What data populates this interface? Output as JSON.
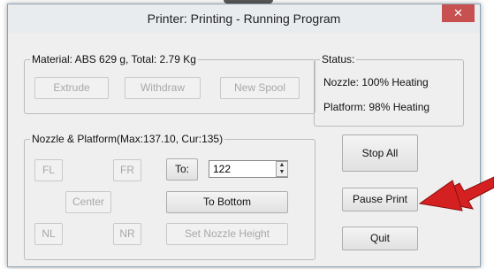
{
  "window": {
    "title": "Printer: Printing - Running Program",
    "close_glyph": "✕"
  },
  "material": {
    "legend": "Material: ABS 629 g,  Total: 2.79 Kg",
    "buttons": {
      "extrude": "Extrude",
      "withdraw": "Withdraw",
      "new_spool": "New Spool"
    }
  },
  "status": {
    "legend": "Status:",
    "nozzle": "Nozzle: 100%  Heating",
    "platform": "Platform: 98%  Heating"
  },
  "nozzle_platform": {
    "legend": "Nozzle & Platform(Max:137.10, Cur:135)",
    "buttons": {
      "fl": "FL",
      "fr": "FR",
      "to": "To:",
      "center": "Center",
      "to_bottom": "To Bottom",
      "nl": "NL",
      "nr": "NR",
      "set_nozzle_height": "Set Nozzle Height"
    },
    "height_value": "122"
  },
  "actions": {
    "stop_all": "Stop All",
    "pause_print": "Pause Print",
    "quit": "Quit"
  },
  "colors": {
    "arrow": "#d42020",
    "close_bg": "#c75050"
  },
  "icons": {
    "spin_up": "▲",
    "spin_down": "▼"
  }
}
